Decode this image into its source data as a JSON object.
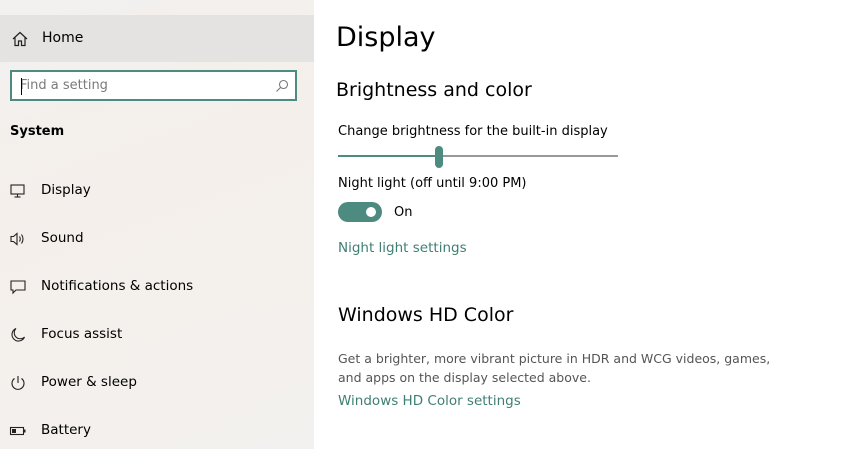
{
  "sidebar": {
    "home_label": "Home",
    "search": {
      "placeholder": "Find a setting",
      "value": ""
    },
    "section_title": "System",
    "items": [
      {
        "label": "Display",
        "icon": "monitor-icon"
      },
      {
        "label": "Sound",
        "icon": "speaker-icon"
      },
      {
        "label": "Notifications & actions",
        "icon": "notification-icon"
      },
      {
        "label": "Focus assist",
        "icon": "moon-icon"
      },
      {
        "label": "Power & sleep",
        "icon": "power-icon"
      },
      {
        "label": "Battery",
        "icon": "battery-icon"
      }
    ]
  },
  "main": {
    "title": "Display",
    "brightness_section": "Brightness and color",
    "brightness_label": "Change brightness for the built-in display",
    "brightness_value": 0.36,
    "night_light_label": "Night light (off until 9:00 PM)",
    "night_light_state": "On",
    "night_light_link": "Night light settings",
    "hd_title": "Windows HD Color",
    "hd_desc": "Get a brighter, more vibrant picture in HDR and WCG videos, games, and apps on the display selected above.",
    "hd_link": "Windows HD Color settings"
  },
  "colors": {
    "accent": "#4d8a80",
    "link": "#3f7f73"
  }
}
